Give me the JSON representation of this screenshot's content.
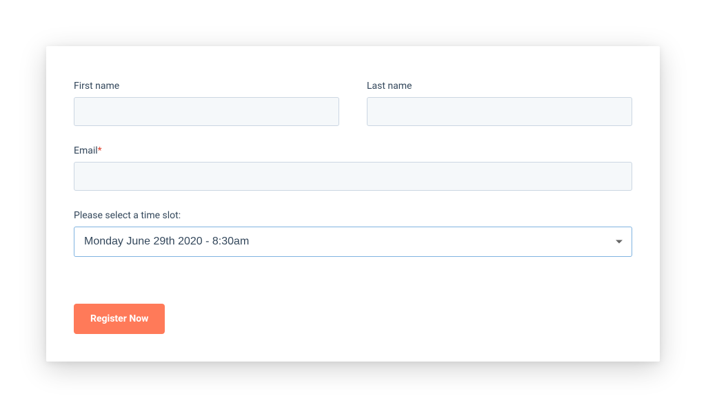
{
  "form": {
    "first_name": {
      "label": "First name",
      "value": ""
    },
    "last_name": {
      "label": "Last name",
      "value": ""
    },
    "email": {
      "label": "Email",
      "required_marker": "*",
      "value": ""
    },
    "time_slot": {
      "label": "Please select a time slot:",
      "selected": "Monday June 29th 2020 - 8:30am"
    },
    "submit_label": "Register Now"
  }
}
